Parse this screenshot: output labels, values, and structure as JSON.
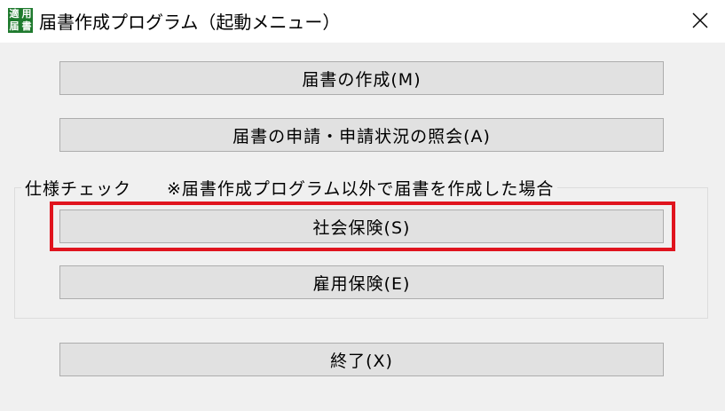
{
  "titlebar": {
    "icon_text": [
      "適",
      "用",
      "届",
      "書"
    ],
    "title": "届書作成プログラム（起動メニュー）"
  },
  "menu": {
    "create_label": "届書の作成(M)",
    "apply_label": "届書の申請・申請状況の照会(A)",
    "exit_label": "終了(X)"
  },
  "spec_check": {
    "label": "仕様チェック",
    "note": "※届書作成プログラム以外で届書を作成した場合",
    "social_insurance_label": "社会保険(S)",
    "employment_insurance_label": "雇用保険(E)"
  },
  "colors": {
    "highlight": "#e0141e",
    "icon_bg": "#1f7a2e",
    "button_bg": "#e1e1e1"
  }
}
